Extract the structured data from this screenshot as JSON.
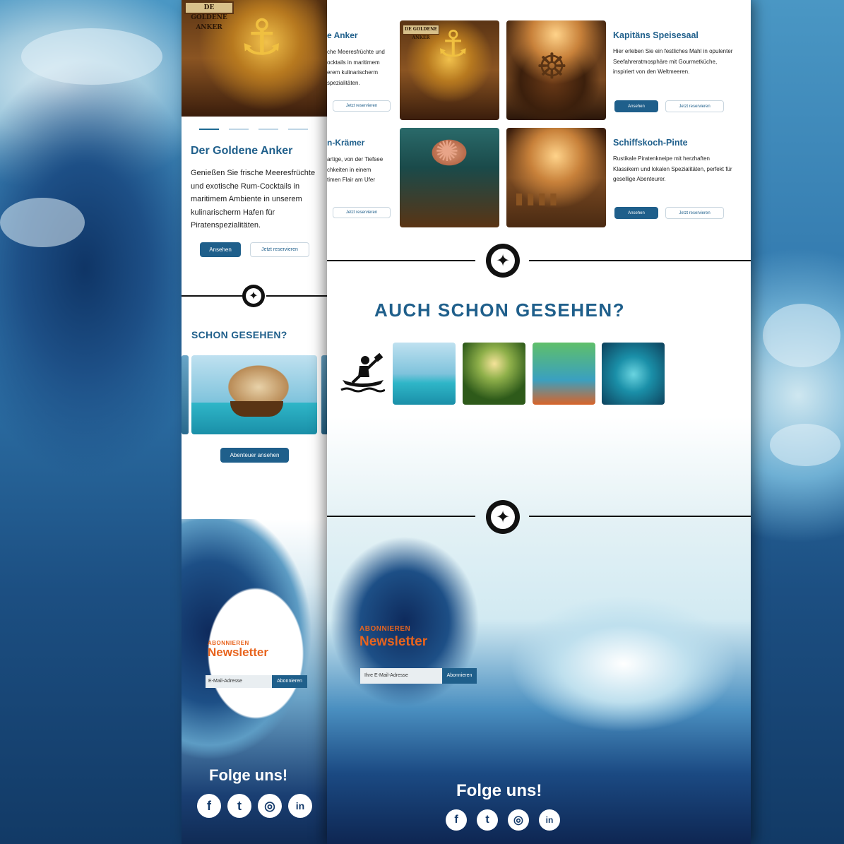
{
  "mobile": {
    "hero_sign": "DE GOLDENE ANKER",
    "title": "Der Goldene Anker",
    "description": "Genießen Sie frische Meeresfrüchte und exotische Rum-Cocktails in maritimem Ambiente in unserem kulinarischerm Hafen für Piratenspezialitäten.",
    "view_button": "Ansehen",
    "reserve_button": "Jetzt reservieren",
    "section_title": "SCHON GESEHEN?",
    "adventure_button": "Abenteuer ansehen",
    "newsletter_kicker": "ABONNIEREN",
    "newsletter_title": "Newsletter",
    "email_placeholder": "E-Mail-Adresse",
    "subscribe_button": "Abonnieren",
    "follow_title": "Folge uns!"
  },
  "desktop": {
    "left_cards": [
      {
        "title": "e Anker",
        "text": [
          "che Meeresfrüchte und",
          "ocktails in maritimem",
          "erem kulinarischerm",
          "spezialitäten."
        ],
        "reserve": "Jetzt reservieren"
      },
      {
        "title": "n-Krämer",
        "text": [
          "artige, von der Tiefsee",
          "chkeiten in einem",
          "timen Flair am Ufer"
        ],
        "reserve": "Jetzt reservieren"
      }
    ],
    "cards": [
      {
        "title": "Kapitäns Speisesaal",
        "text": "Hier erleben Sie ein festliches Mahl in opulenter Seefahreratmosphäre mit Gourmetküche, inspiriert von den Weltmeeren.",
        "view": "Ansehen",
        "reserve": "Jetzt reservieren"
      },
      {
        "title": "Schiffskoch-Pinte",
        "text": "Rustikale Piratenkneipe mit herzhaften Klassikern und lokalen Spezialitäten, perfekt für gesellige Abenteurer.",
        "view": "Ansehen",
        "reserve": "Jetzt reservieren"
      }
    ],
    "image_sign": "DE GOLDENE ANKER",
    "section_title": "AUCH SCHON GESEHEN?",
    "newsletter_kicker": "ABONNIEREN",
    "newsletter_title": "Newsletter",
    "email_placeholder": "Ihre E-Mail-Adresse",
    "subscribe_button": "Abonnieren",
    "follow_title": "Folge uns!"
  },
  "social": [
    {
      "name": "facebook-icon",
      "glyph": "f"
    },
    {
      "name": "twitter-icon",
      "glyph": "t"
    },
    {
      "name": "instagram-icon",
      "glyph": "◎"
    },
    {
      "name": "linkedin-icon",
      "glyph": "in"
    }
  ],
  "colors": {
    "brand_blue": "#1f5f8b",
    "accent_orange": "#e8641e",
    "divider": "#111111"
  }
}
